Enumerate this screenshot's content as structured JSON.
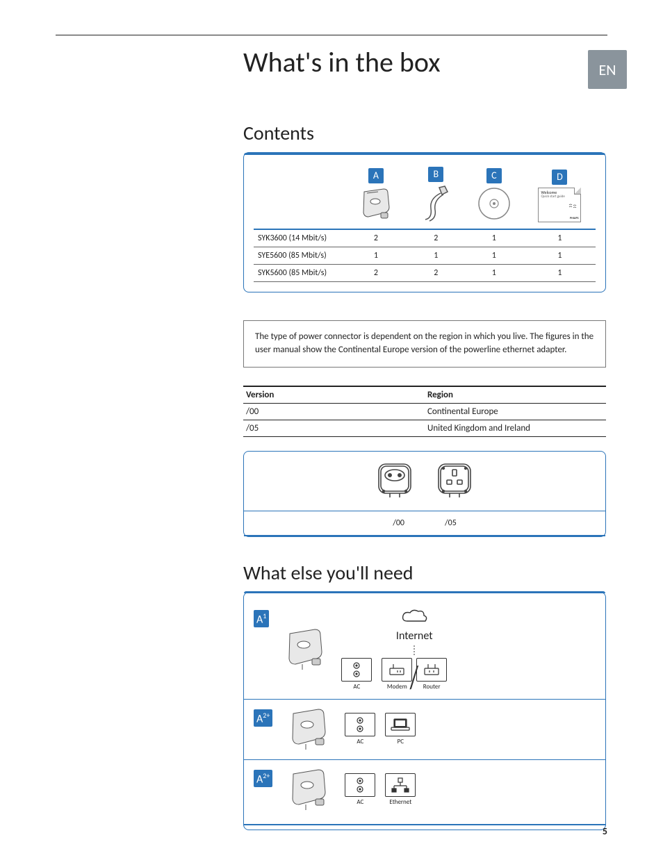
{
  "lang_tab": "EN",
  "page_title": "What's in the box",
  "sections": {
    "contents": "Contents",
    "what_else": "What else you'll need"
  },
  "contents_table": {
    "columns": [
      "A",
      "B",
      "C",
      "D"
    ],
    "column_d_card": {
      "line1": "Welcome",
      "line2": "Quick start guide",
      "brand": "PHILIPS"
    },
    "rows": [
      {
        "label": "SYK3600 (14 Mbit/s)",
        "a": "2",
        "b": "2",
        "c": "1",
        "d": "1"
      },
      {
        "label": "SYE5600 (85 Mbit/s)",
        "a": "1",
        "b": "1",
        "c": "1",
        "d": "1"
      },
      {
        "label": "SYK5600 (85 Mbit/s)",
        "a": "2",
        "b": "2",
        "c": "1",
        "d": "1"
      }
    ]
  },
  "note_text": "The type of power connector is dependent on the region in which you live.  The figures in the user manual show the Continental Europe version of the powerline ethernet adapter.",
  "version_table": {
    "headers": {
      "version": "Version",
      "region": "Region"
    },
    "rows": [
      {
        "version": "/00",
        "region": "Continental Europe"
      },
      {
        "version": "/05",
        "region": "United Kingdom and Ireland"
      }
    ]
  },
  "plug_labels": {
    "left": "/00",
    "right": "/05"
  },
  "needs": {
    "badge_a1": "A",
    "badge_a1_sup": "1",
    "badge_a2": "A",
    "badge_a2_sup": "2+",
    "icons": {
      "ac": "AC",
      "modem": "Modem",
      "router": "Router",
      "pc": "PC",
      "ethernet": "Ethernet",
      "internet": "Internet"
    }
  },
  "page_number": "5"
}
